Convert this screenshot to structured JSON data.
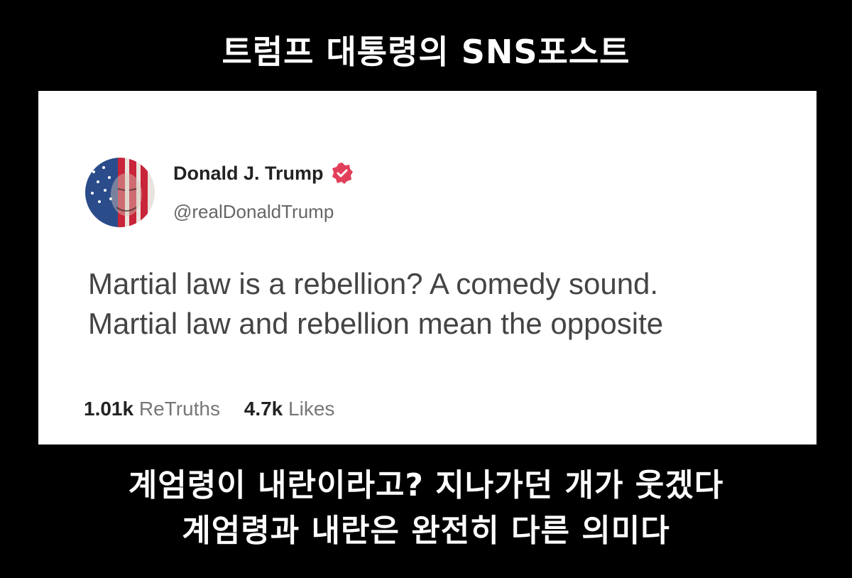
{
  "top_caption": "트럼프 대통령의 SNS포스트",
  "post": {
    "author_name": "Donald J. Trump",
    "handle": "@realDonaldTrump",
    "text_lines": [
      "Martial law is a rebellion?  A comedy sound.",
      "Martial law and rebellion mean the opposite"
    ],
    "retruths_count": "1.01k",
    "retruths_label": "ReTruths",
    "likes_count": "4.7k",
    "likes_label": "Likes",
    "avatar_icon": "flag-face-avatar-icon",
    "verified_icon": "verified-badge-icon",
    "verified_color": "#e2405a"
  },
  "bottom_caption": {
    "line1": "계엄령이 내란이라고? 지나가던 개가 웃겠다",
    "line2": "계엄령과 내란은 완전히 다른 의미다"
  }
}
